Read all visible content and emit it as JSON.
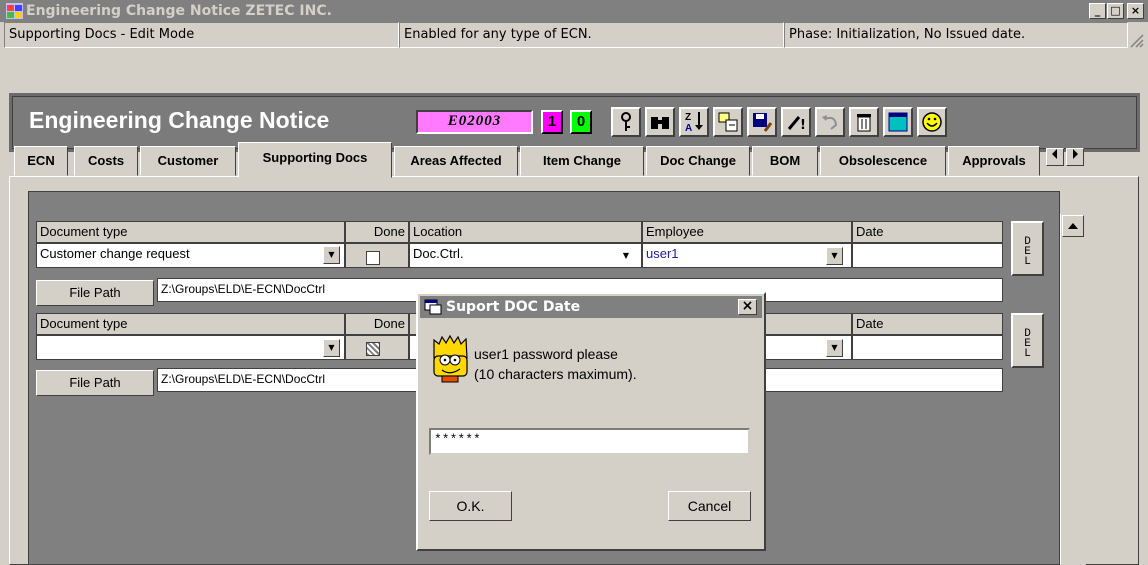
{
  "window": {
    "title": "Engineering Change Notice ZETEC INC.",
    "minimize_glyph": "_",
    "maximize_glyph": "□",
    "close_glyph": "×"
  },
  "status_bar": {
    "mode": "Supporting Docs - Edit Mode",
    "ecn_type": "Enabled for any type of ECN.",
    "phase": "Phase: Initialization, No Issued date."
  },
  "header": {
    "title": "Engineering Change Notice",
    "ecn_number": "E02003",
    "counter_1": "1",
    "counter_2": "0",
    "colors": {
      "ecn_box": "#ff7aff",
      "counter_1": "#ff00ff",
      "counter_2": "#00ff00"
    }
  },
  "toolbar": {
    "icons": [
      "key-icon",
      "binoculars-icon",
      "sort-az-icon",
      "add-record-icon",
      "save-icon",
      "edit-icon",
      "undo-icon",
      "trash-icon",
      "form-icon",
      "smiley-icon"
    ]
  },
  "tabs": [
    {
      "label": "ECN"
    },
    {
      "label": "Costs"
    },
    {
      "label": "Customer"
    },
    {
      "label": "Supporting Docs"
    },
    {
      "label": "Areas Affected"
    },
    {
      "label": "Item Change"
    },
    {
      "label": "Doc Change"
    },
    {
      "label": "BOM"
    },
    {
      "label": "Obsolescence"
    },
    {
      "label": "Approvals"
    }
  ],
  "grid": {
    "columns": [
      "Document type",
      "Done",
      "Location",
      "Employee",
      "Date"
    ],
    "rows": [
      {
        "document_type": "Customer change request",
        "done": false,
        "location": "Doc.Ctrl.",
        "employee": "user1",
        "date": "",
        "file_path_label": "File Path",
        "file_path": "Z:\\Groups\\ELD\\E-ECN\\DocCtrl",
        "del_label": "D\nE\nL"
      },
      {
        "document_type": "",
        "done": "indeterminate",
        "location": "",
        "employee": "",
        "date": "",
        "file_path_label": "File Path",
        "file_path": "Z:\\Groups\\ELD\\E-ECN\\DocCtrl",
        "del_label": "D\nE\nL"
      }
    ]
  },
  "dialog": {
    "title": "Suport DOC Date",
    "message_line1": "user1 password please",
    "message_line2": "(10 characters maximum).",
    "password_value": "******",
    "ok_label": "O.K.",
    "cancel_label": "Cancel"
  }
}
